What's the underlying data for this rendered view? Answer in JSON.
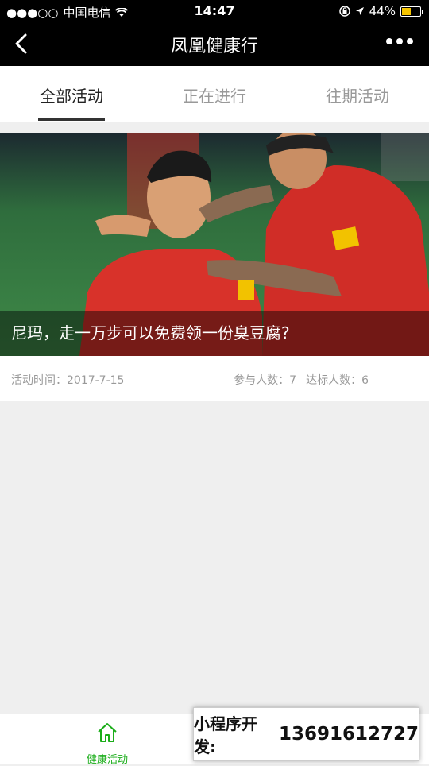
{
  "status": {
    "carrier": "中国电信",
    "time": "14:47",
    "battery": "44%",
    "battery_color": "#f5c400"
  },
  "nav": {
    "title": "凤凰健康行",
    "back_icon": "chevron-left-icon",
    "more_icon": "more-dots-icon"
  },
  "tabs": [
    {
      "label": "全部活动",
      "active": true
    },
    {
      "label": "正在进行",
      "active": false
    },
    {
      "label": "往期活动",
      "active": false
    }
  ],
  "activity": {
    "caption": "尼玛，走一万步可以免费领一份臭豆腐?",
    "time_label": "活动时间：2017-7-15",
    "participants_label": "参与人数：7",
    "qualified_label": "达标人数：6"
  },
  "bottom": {
    "tab1_label": "健康活动",
    "tab1_color": "#1aad19"
  },
  "overlay": {
    "prefix": "小程序开发:",
    "phone": "13691612727"
  }
}
